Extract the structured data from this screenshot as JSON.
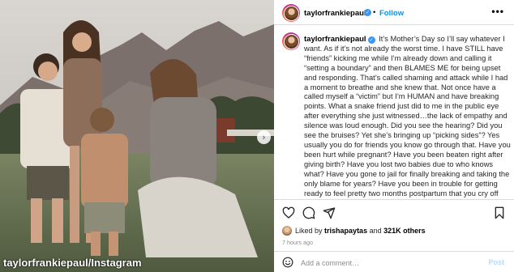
{
  "colors": {
    "accent": "#0095f6",
    "verified": "#3897f0",
    "muted": "#8e8e8e",
    "border": "#dbdbdb"
  },
  "photo": {
    "watermark": "taylorfrankiepaul/Instagram",
    "next_icon": "chevron-right-icon"
  },
  "header": {
    "username": "taylorfrankiepaul",
    "verified_icon": "verified-badge-icon",
    "separator": "•",
    "follow_label": "Follow",
    "more_icon": "more-options-icon",
    "more_glyph": "•••"
  },
  "caption": {
    "username": "taylorfrankiepaul",
    "text": "It’s Mother’s Day so I’ll say whatever I want. As if it’s not already the worst time. I have STILL have “friends” kicking me while I’m already down and calling it “setting a boundary” and then BLAMES ME for being upset and responding. That’s called shaming and attack while I had a moment to breathe and she knew that. Not once have a called myself a “victim” but I’m HUMAN and have breaking points. What a snake friend just did to me in the public eye after everything she just witnessed…the lack of empathy and silence was loud enough. Did you see the hearing? Did you see the bruises? Yet she’s bringing up “picking sides”? Yes usually you do for friends you know go through that. Have you been hurt while pregnant? Have you been beaten right after giving birth? Have you lost two babies due to who knows what? Have you gone to jail for finally breaking and taking the only blame for years? Have you been in trouble for getting ready to feel pretty two months postpartum that you cry off your make up and return to an ugly tee shirt? Can you even understand what I’m saying just from just a psychological point? No clearly not, if it’s being used as an"
  },
  "actions": {
    "like_icon": "heart-icon",
    "comment_icon": "comment-icon",
    "share_icon": "share-icon",
    "save_icon": "bookmark-icon"
  },
  "likes": {
    "prefix": "Liked by ",
    "user": "trishapaytas",
    "middle": " and ",
    "others": "321K others"
  },
  "timestamp": "7 hours ago",
  "comment_box": {
    "emoji_icon": "emoji-icon",
    "placeholder": "Add a comment…",
    "post_label": "Post"
  }
}
